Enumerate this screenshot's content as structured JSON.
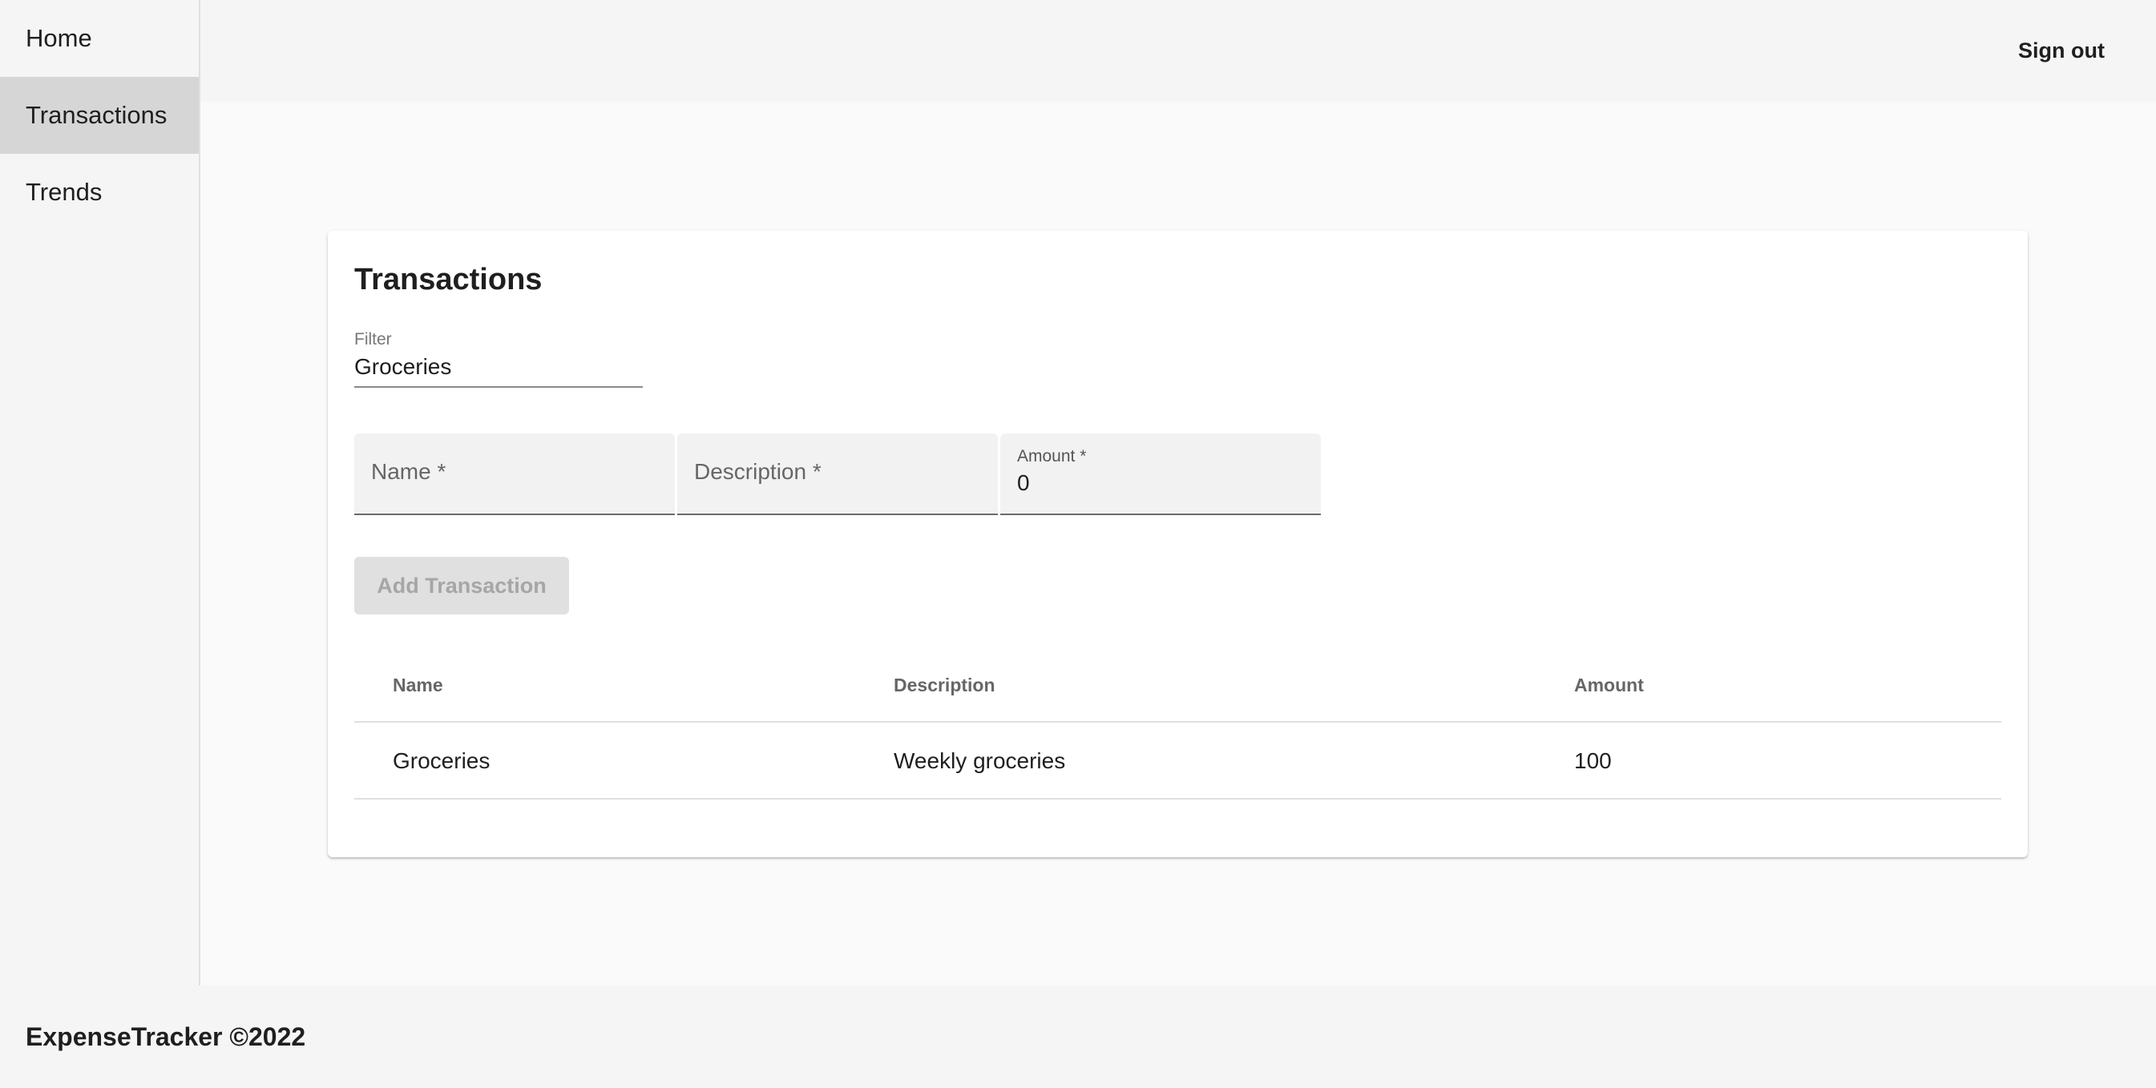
{
  "sidebar": {
    "items": [
      {
        "label": "Home",
        "active": false
      },
      {
        "label": "Transactions",
        "active": true
      },
      {
        "label": "Trends",
        "active": false
      }
    ]
  },
  "header": {
    "signout_label": "Sign out"
  },
  "card": {
    "title": "Transactions",
    "filter": {
      "label": "Filter",
      "value": "Groceries"
    },
    "fields": {
      "name_placeholder": "Name *",
      "description_placeholder": "Description *",
      "amount_label": "Amount *",
      "amount_value": "0"
    },
    "add_button_label": "Add Transaction",
    "table": {
      "headers": [
        "Name",
        "Description",
        "Amount"
      ],
      "rows": [
        {
          "name": "Groceries",
          "description": "Weekly groceries",
          "amount": "100"
        }
      ]
    }
  },
  "footer": {
    "text": "ExpenseTracker ©2022"
  },
  "colors": {
    "sidebar_bg": "#f5f5f5",
    "active_item_bg": "#d6d6d6",
    "page_bg": "#fafafa",
    "card_bg": "#ffffff",
    "disabled_button_bg": "#e0e0e0",
    "disabled_button_text": "#a6a6a6"
  }
}
